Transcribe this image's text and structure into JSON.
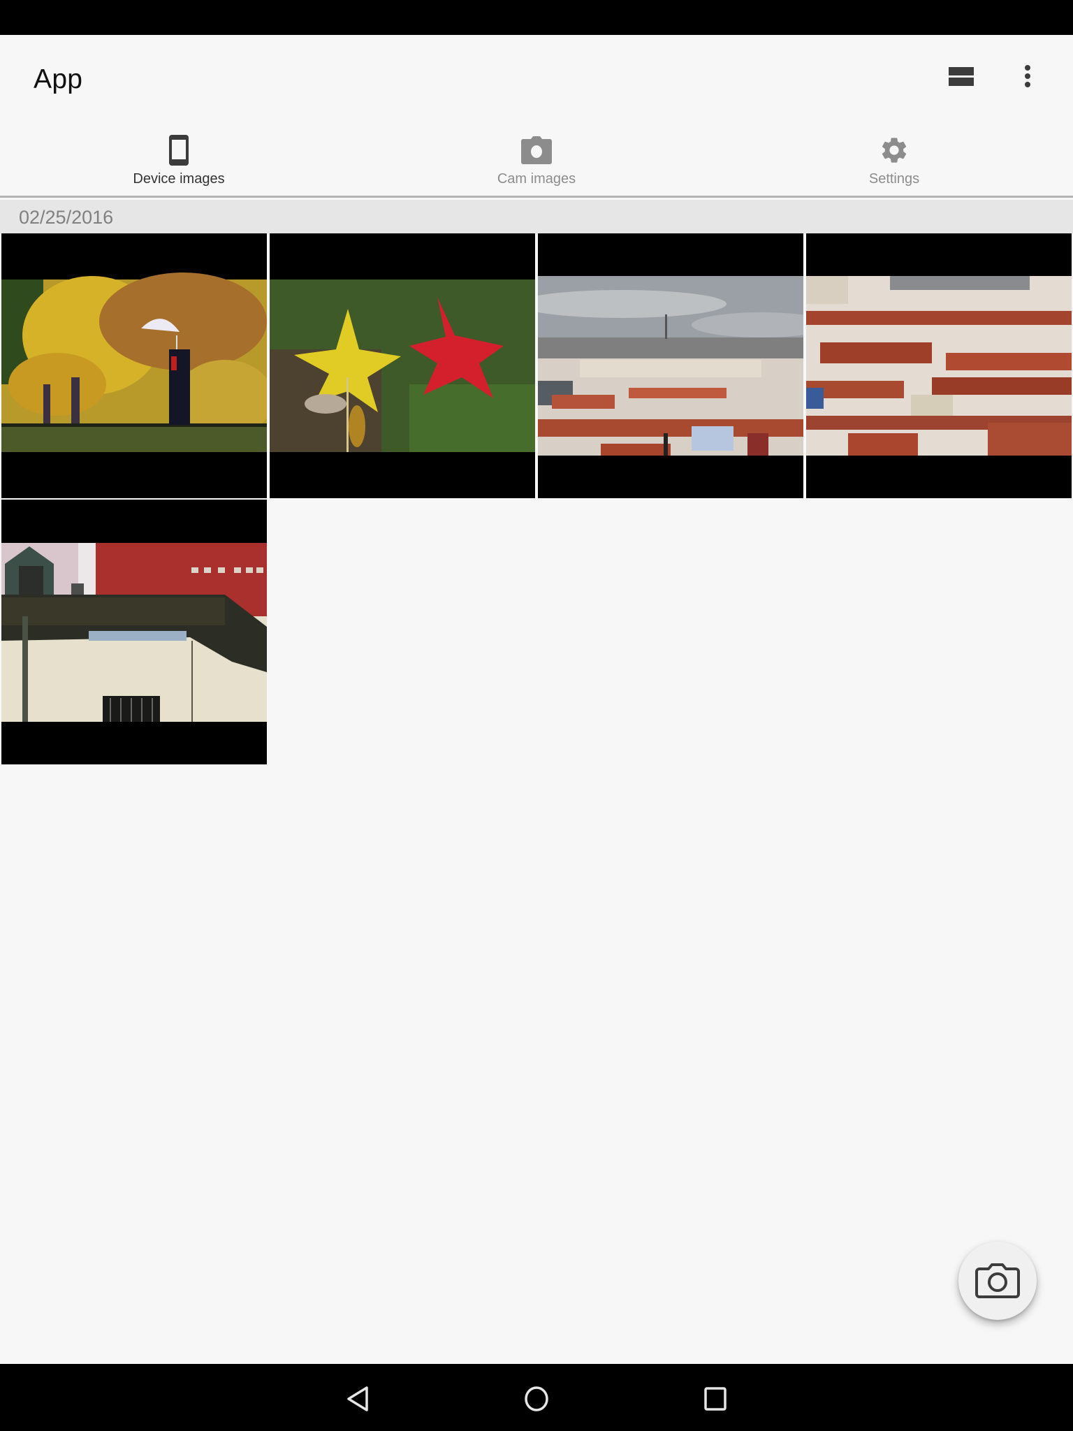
{
  "app": {
    "title": "App"
  },
  "toolbar": {
    "actions": [
      {
        "icon": "view-agenda-icon",
        "label": "Change view"
      },
      {
        "icon": "more-vert-icon",
        "label": "More options"
      }
    ]
  },
  "tabs": [
    {
      "label": "Device images",
      "icon": "smartphone-icon",
      "active": true
    },
    {
      "label": "Cam images",
      "icon": "camera-icon",
      "active": false
    },
    {
      "label": "Settings",
      "icon": "gear-icon",
      "active": false
    }
  ],
  "gallery": {
    "date_header": "02/25/2016",
    "images": [
      {
        "subject": "autumn trees with person holding white umbrella"
      },
      {
        "subject": "yellow and red star-shaped leaves on grass"
      },
      {
        "subject": "city skyline with red rooftops under cloudy sky"
      },
      {
        "subject": "dense red-roofed buildings"
      },
      {
        "subject": "building with dormer window and red wall"
      }
    ]
  },
  "fab": {
    "icon": "camera-outline-icon",
    "label": "Take photo"
  },
  "navigation_bar": {
    "buttons": [
      {
        "icon": "back-icon"
      },
      {
        "icon": "home-icon"
      },
      {
        "icon": "recents-icon"
      }
    ]
  },
  "colors": {
    "background": "#f7f7f7",
    "date_header_bg": "#e6e6e6",
    "active_tab_text": "#333333",
    "inactive_tab_text": "#8c8c8c",
    "icon_dark": "#3c3c3c"
  }
}
